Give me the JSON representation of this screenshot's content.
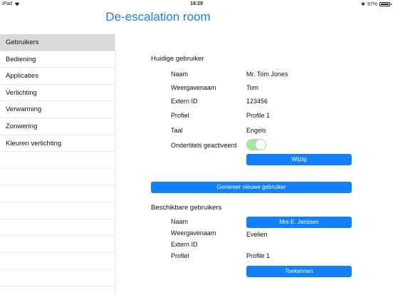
{
  "statusbar": {
    "device": "iPad",
    "time": "18:29",
    "bluetooth": "✱",
    "battery_percent": "97%",
    "battery_level": 0.97
  },
  "app": {
    "title": "De-escalation room"
  },
  "sidebar": {
    "items": [
      {
        "label": "Gebruikers",
        "selected": true
      },
      {
        "label": "Bediening"
      },
      {
        "label": "Applicaties"
      },
      {
        "label": "Verlichting"
      },
      {
        "label": "Verwarming"
      },
      {
        "label": "Zonwering"
      },
      {
        "label": "Kleuren verlichting"
      }
    ]
  },
  "current_user": {
    "heading": "Huidige gebruiker",
    "name_label": "Naam",
    "name_value": "Mr. Tom Jones",
    "display_label": "Weergavenaam",
    "display_value": "Tom",
    "extern_label": "Extern ID",
    "extern_value": "123456",
    "profile_label": "Profiel",
    "profile_value": "Profile 1",
    "language_label": "Taal",
    "language_value": "Engels",
    "subtitles_label": "Ondertitels geactiveerd",
    "subtitles_on": true,
    "change_button": "Wijzig"
  },
  "generate_button": "Genereer nieuwe gebruiker",
  "available_users": {
    "heading": "Beschikbare gebruikers",
    "name_label": "Naam",
    "name_button": "Mrs E. Janssen",
    "display_label": "Weergavenaam",
    "display_value": "Evelien",
    "extern_label": "Extern ID",
    "extern_value": "",
    "profile_label": "Profiel",
    "profile_value": "Profile 1",
    "assign_button": "Toekennen"
  },
  "colors": {
    "accent": "#1080ff",
    "title": "#1a7cff",
    "toggle_on": "#a8e6a8",
    "sidebar_selected": "#d9d9d9"
  }
}
